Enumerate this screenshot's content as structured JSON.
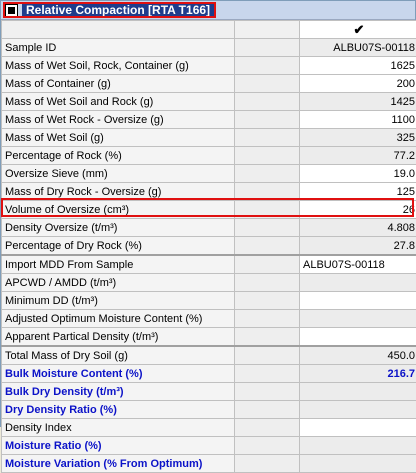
{
  "window": {
    "title": "Relative Compaction [RTA T166]"
  },
  "header": {
    "check_mark": "✔"
  },
  "rows": [
    {
      "label": "Sample ID",
      "value": "ALBU07S-00118"
    },
    {
      "label": "Mass of Wet Soil, Rock, Container (g)",
      "value": "1625"
    },
    {
      "label": "Mass of Container (g)",
      "value": "200"
    },
    {
      "label": "Mass of Wet Soil and Rock (g)",
      "value": "1425"
    },
    {
      "label": "Mass of Wet Rock - Oversize (g)",
      "value": "1100"
    },
    {
      "label": "Mass of Wet Soil (g)",
      "value": "325"
    },
    {
      "label": "Percentage of Rock (%)",
      "value": "77.2"
    },
    {
      "label": "Oversize Sieve (mm)",
      "value": "19.0"
    },
    {
      "label": "Mass of Dry Rock - Oversize (g)",
      "value": "125"
    },
    {
      "label": "Volume of Oversize (cm³)",
      "value": "26"
    },
    {
      "label": "Density Oversize (t/m³)",
      "value": "4.808"
    },
    {
      "label": "Percentage of Dry Rock (%)",
      "value": "27.8"
    },
    {
      "label": "Import MDD From Sample",
      "value": "ALBU07S-00118"
    },
    {
      "label": "APCWD / AMDD (t/m³)",
      "value": ""
    },
    {
      "label": "Minimum DD (t/m³)",
      "value": ""
    },
    {
      "label": "Adjusted Optimum Moisture Content (%)",
      "value": ""
    },
    {
      "label": "Apparent Partical Density (t/m³)",
      "value": ""
    },
    {
      "label": "Total Mass of Dry Soil (g)",
      "value": "450.0"
    },
    {
      "label": "Bulk Moisture Content (%)",
      "value": "216.7"
    },
    {
      "label": "Bulk Dry Density (t/m³)",
      "value": ""
    },
    {
      "label": "Dry Density Ratio (%)",
      "value": ""
    },
    {
      "label": "Density Index",
      "value": ""
    },
    {
      "label": "Moisture Ratio (%)",
      "value": ""
    },
    {
      "label": "Moisture Variation (% From Optimum)",
      "value": ""
    }
  ],
  "colors": {
    "accent_label": "#0b12c8",
    "highlight": "#e01010",
    "title_bg": "#1e3c8c"
  }
}
